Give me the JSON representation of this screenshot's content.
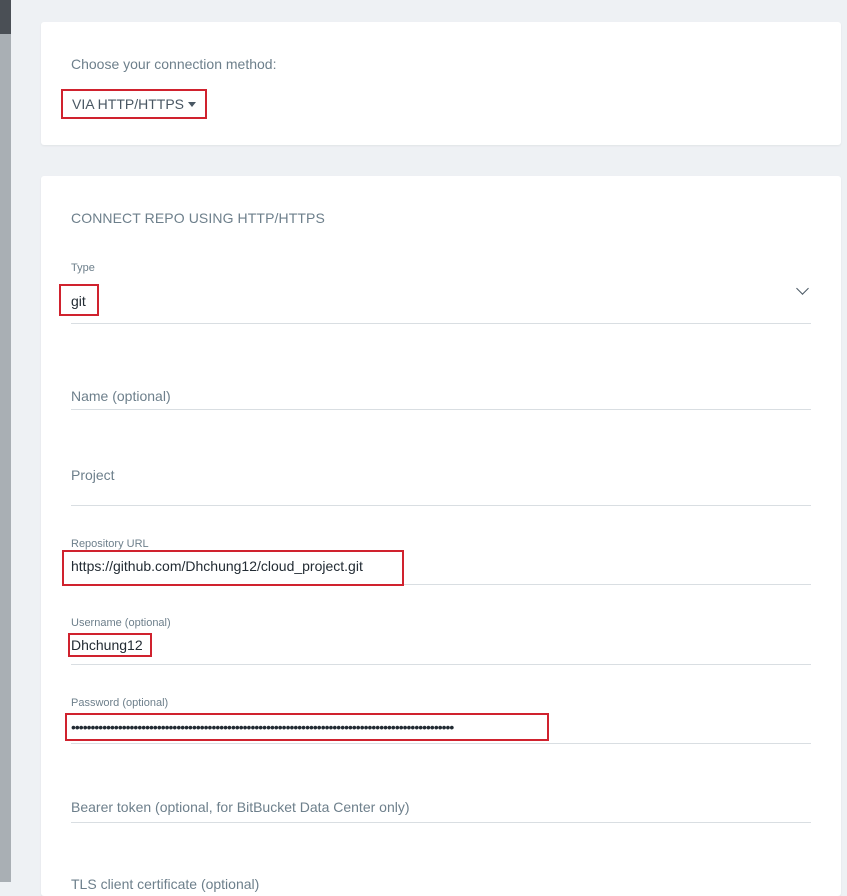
{
  "connection": {
    "label": "Choose your connection method:",
    "method": "VIA HTTP/HTTPS"
  },
  "form": {
    "title": "CONNECT REPO USING HTTP/HTTPS",
    "type": {
      "label": "Type",
      "value": "git"
    },
    "name": {
      "placeholder": "Name (optional)"
    },
    "project": {
      "placeholder": "Project"
    },
    "repo_url": {
      "label": "Repository URL",
      "value": "https://github.com/Dhchung12/cloud_project.git"
    },
    "username": {
      "label": "Username (optional)",
      "value": "Dhchung12"
    },
    "password": {
      "label": "Password (optional)",
      "value": "••••••••••••••••••••••••••••••••••••••••••••••••••••••••••••••••••••••••••••••••••••••••••••••••••"
    },
    "bearer": {
      "placeholder": "Bearer token (optional, for BitBucket Data Center only)"
    },
    "tls": {
      "placeholder": "TLS client certificate (optional)"
    }
  },
  "colors": {
    "highlight": "#d0222e",
    "background": "#eef1f4"
  }
}
